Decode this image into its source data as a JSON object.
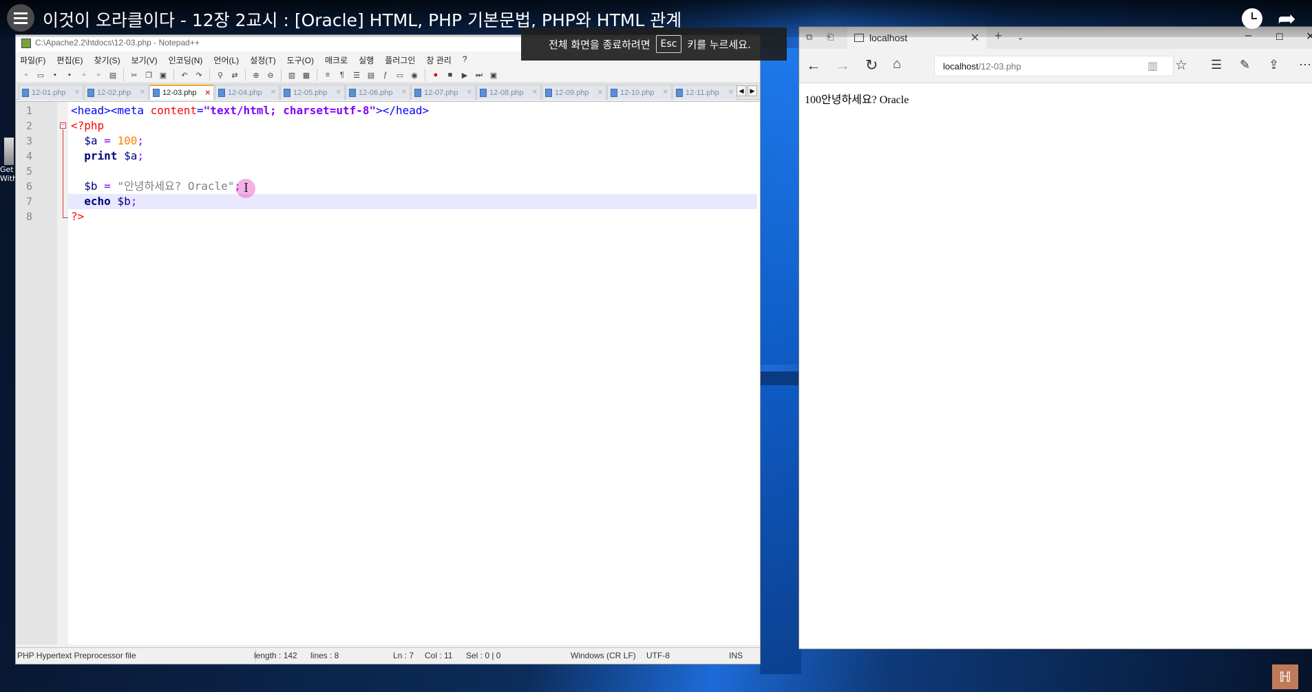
{
  "video": {
    "title": "이것이 오라클이다 - 12장 2교시 : [Oracle] HTML, PHP 기본문법, PHP와 HTML 관계"
  },
  "fullscreen_notice": {
    "before": "전체 화면을 종료하려면",
    "key": "Esc",
    "after": "키를 누르세요."
  },
  "desktop": {
    "icon_label_1": "Get",
    "icon_label_2": "With"
  },
  "notepad": {
    "title": "C:\\Apache2.2\\htdocs\\12-03.php - Notepad++",
    "menu": [
      "파일(F)",
      "편집(E)",
      "찾기(S)",
      "보기(V)",
      "인코딩(N)",
      "언어(L)",
      "설정(T)",
      "도구(O)",
      "매크로",
      "실행",
      "플러그인",
      "창 관리",
      "?"
    ],
    "tabs": [
      "12-01.php",
      "12-02.php",
      "12-03.php",
      "12-04.php",
      "12-05.php",
      "12-06.php",
      "12-07.php",
      "12-08.php",
      "12-09.php",
      "12-10.php",
      "12-11.php"
    ],
    "active_tab": "12-03.php",
    "line_numbers": [
      "1",
      "2",
      "3",
      "4",
      "5",
      "6",
      "7",
      "8"
    ],
    "code": {
      "l1_open": "<head><meta ",
      "l1_attr": "content",
      "l1_eq": "=",
      "l1_val": "\"text/html; charset=utf-8\"",
      "l1_close": "></head>",
      "l2": "<?php",
      "l3_var": "$a",
      "l3_op": " = ",
      "l3_num": "100",
      "l3_end": ";",
      "l4_kw": "print",
      "l4_var": " $a",
      "l4_end": ";",
      "l6_var": "$b",
      "l6_op": " = ",
      "l6_str": "\"안녕하세요? Oracle\"",
      "l6_end": ";",
      "l7_kw": "echo",
      "l7_var": " $b",
      "l7_end": ";",
      "l8": "?>"
    },
    "status": {
      "file_type": "PHP Hypertext Preprocessor file",
      "length": "length : 142",
      "lines": "lines : 8",
      "ln": "Ln : 7",
      "col": "Col : 11",
      "sel": "Sel : 0 | 0",
      "eol": "Windows (CR LF)",
      "encoding": "UTF-8",
      "mode": "INS"
    }
  },
  "browser": {
    "tab_title": "localhost",
    "url_host": "localhost",
    "url_path": "/12-03.php",
    "page_output": "100안녕하세요? Oracle"
  },
  "icons": {
    "menu": "hamburger-menu-icon",
    "clock": "watch-later-icon",
    "share": "share-arrow-icon",
    "back": "back-arrow-icon",
    "forward": "forward-arrow-icon",
    "refresh": "refresh-icon",
    "home": "home-icon",
    "reading": "reading-view-icon",
    "favorite": "star-icon",
    "hub": "favorites-hub-icon",
    "note": "pen-icon",
    "share_browser": "share-icon",
    "more": "more-icon"
  }
}
